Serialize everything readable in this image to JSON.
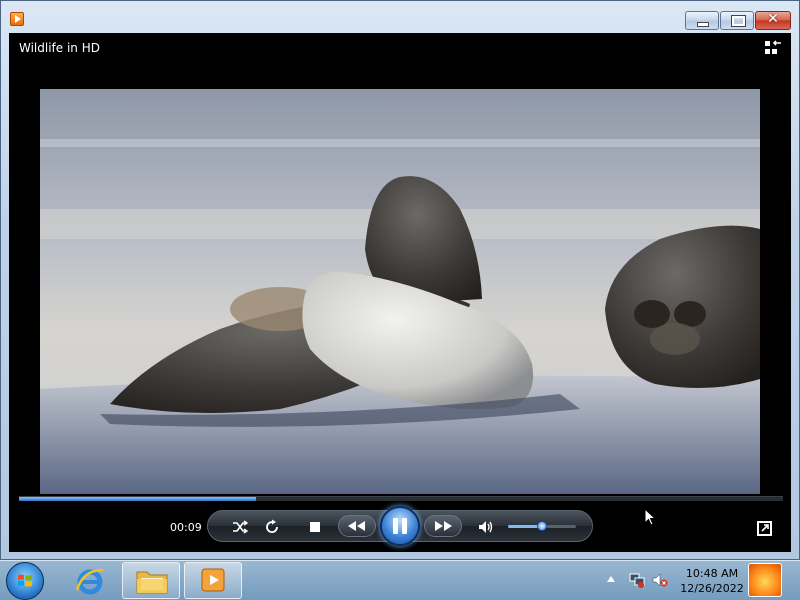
{
  "window": {
    "app_name": "Windows Media Player",
    "close_symbol": "✕"
  },
  "player": {
    "media_title": "Wildlife in HD",
    "elapsed_time": "00:09",
    "progress": 0.31,
    "volume": 0.5,
    "icons": [
      "switch-to-library-icon",
      "shuffle-icon",
      "repeat-icon",
      "stop-icon",
      "rewind-icon",
      "pause-icon",
      "fast-forward-icon",
      "speaker-icon",
      "fullscreen-icon"
    ]
  },
  "taskbar": {
    "pinned": [
      "Internet Explorer",
      "Windows Explorer",
      "Windows Media Player"
    ],
    "clock_time": "10:48 AM",
    "clock_date": "12/26/2022"
  },
  "colors": {
    "accent": "#2d73c8",
    "close_red": "#c4331f"
  }
}
